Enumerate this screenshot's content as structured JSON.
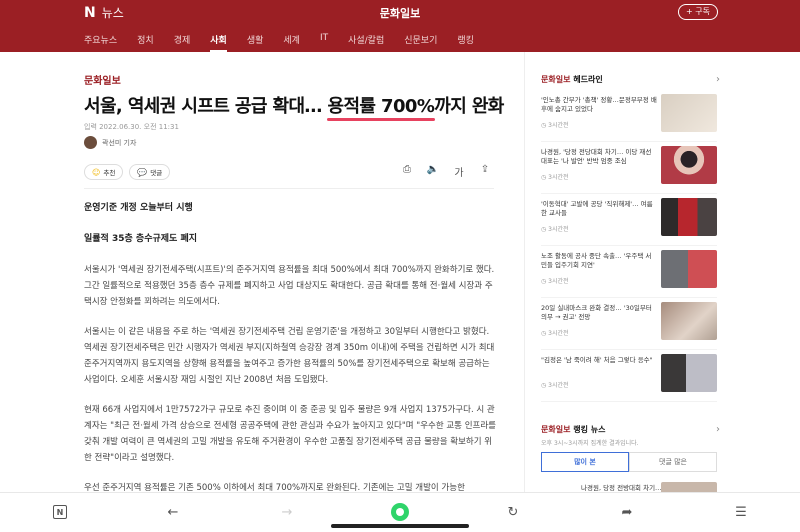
{
  "header": {
    "brand_n": "N",
    "brand_news": "뉴스",
    "publisher": "문화일보",
    "subscribe": "+ 구독",
    "tabs": [
      "주요뉴스",
      "정치",
      "경제",
      "사회",
      "생활",
      "세계",
      "IT",
      "사설/칼럼",
      "신문보기",
      "랭킹"
    ],
    "active_tab": "사회"
  },
  "article": {
    "kicker": "문화일보",
    "headline_pre": "서울, 역세권 시프트 공급 확대… ",
    "headline_hl": "용적률 700%",
    "headline_post": "까지 완화",
    "date": "입력 2022.06.30. 오전 11:31",
    "reporter": "곽선미 기자",
    "recommend": "추천",
    "comment": "댓글",
    "subhead1": "운영기준 개정 오늘부터 시행",
    "subhead2": "일률적 35층 층수규제도 폐지",
    "paragraphs": [
      "서울시가 '역세권 장기전세주택(시프트)'의 준주거지역 용적률을 최대 500%에서 최대 700%까지 완화하기로 했다. 그간 일률적으로 적용했던 35층 층수 규제를 폐지하고 사업 대상지도 확대한다. 공급 확대를 통해 전·월세 시장과 주택시장 안정화를 꾀하려는 의도에서다.",
      "서울시는 이 같은 내용을 주로 하는 '역세권 장기전세주택 건립 운영기준'을 개정하고 30일부터 시행한다고 밝혔다. 역세권 장기전세주택은 민간 시행자가 역세권 부지(지하철역 승강장 경계 350m 이내)에 주택을 건립하면 시가 최대 준주거지역까지 용도지역을 상향해 용적률을 높여주고 증가한 용적률의 50%를 장기전세주택으로 확보해 공급하는 사업이다. 오세훈 서울시장 재임 시절인 지난 2008년 처음 도입됐다.",
      "현재 66개 사업지에서 1만7572가구 규모로 추진 중이며 이 중 준공 및 입주 물량은 9개 사업지 1375가구다. 시 관계자는 \"최근 전·월세 가격 상승으로 전세형 공공주택에 관한 관심과 수요가 높아지고 있다\"며 \"우수한 교통 인프라를 갖춰 개발 여력이 큰 역세권의 고밀 개발을 유도해 주거환경이 우수한 고품질 장기전세주택 공급 물량을 확보하기 위한 전략\"이라고 설명했다.",
      "우선 준주거지역 용적률은 기존 500% 이하에서 최대 700%까지로 완화된다. 기존에는 고밀 개발이 가능한"
    ]
  },
  "sidebar": {
    "headline_pub": "문화일보",
    "headline_label": " 헤드라인",
    "items": [
      {
        "title": "'인노총 간부가 '총책' 정황…문정부부정 배후에 숨지고 있었다",
        "time": "3시간전"
      },
      {
        "title": "나경원, '당정 전당대회 차기… 이당 재선 대표는 '나 발언' 반박 엄중 조심",
        "time": "3시간전"
      },
      {
        "title": "'이동혁대' 고발에 공당 '직위해제'… 여름한 교사들",
        "time": "3시간전"
      },
      {
        "title": "노조 활동에 공사 중단 속출… '우주택 서민들 입주기회 지연'",
        "time": "3시간전"
      },
      {
        "title": "20일 실내마스크 완화 결정… '30일부터 의무 → 권고' 전망",
        "time": "3시간전"
      },
      {
        "title": "\"김정은 '남 죽이려 해' 처음 그렇다 응수\"",
        "time": "3시간전"
      }
    ],
    "ranking_pub": "문화일보",
    "ranking_label": " 랭킹 뉴스",
    "ranking_sub": "오후 3시~3시까지 집계한 결과입니다.",
    "rank_tab1": "많이 본",
    "rank_tab2": "댓글 많은",
    "rank_first": "나경원, 당정 전방대회 차기…"
  }
}
